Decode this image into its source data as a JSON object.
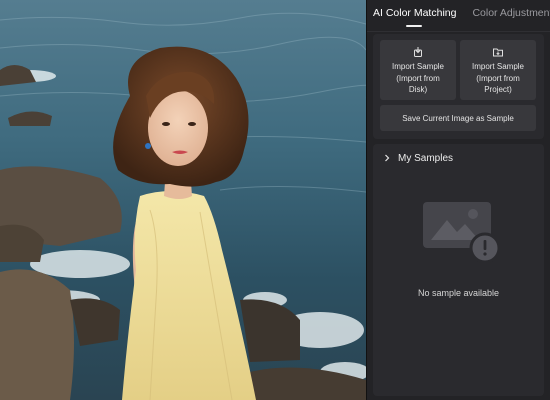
{
  "tabs": [
    {
      "label": "AI Color Matching",
      "active": true
    },
    {
      "label": "Color Adjustment",
      "active": false
    }
  ],
  "import": {
    "from_disk_label": "Import Sample (Import from Disk)",
    "from_disk_lines": [
      "Import Sample",
      "(Import from",
      "Disk)"
    ],
    "from_project_label": "Import Sample (Import from Project)",
    "from_project_lines": [
      "Import Sample",
      "(Import from",
      "Project)"
    ],
    "save_label": "Save Current Image as Sample"
  },
  "samples": {
    "title": "My Samples",
    "empty_text": "No sample available"
  },
  "icons": {
    "disk_import": "disk-import-icon",
    "folder_import": "folder-import-icon",
    "expand": "chevron-right-icon",
    "empty_state": "image-warning-icon"
  },
  "colors": {
    "panel_bg": "#232326",
    "card_bg": "#2a2a2e",
    "button_bg": "#38383c",
    "text_primary": "#ffffff",
    "text_secondary": "#9a9a9f"
  }
}
